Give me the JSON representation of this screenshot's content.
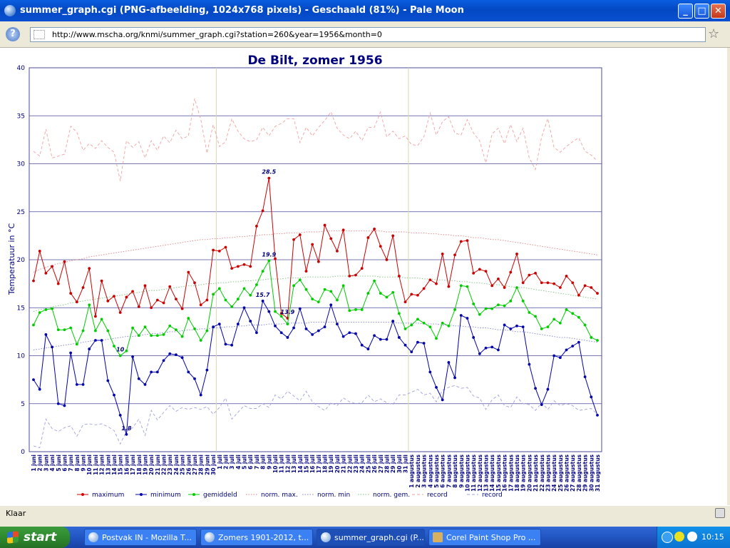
{
  "window": {
    "title": "summer_graph.cgi (PNG-afbeelding, 1024x768 pixels) - Geschaald (81%) - Pale Moon"
  },
  "navbar": {
    "url": "http://www.mscha.org/knmi/summer_graph.cgi?station=260&year=1956&month=0"
  },
  "statusbar": {
    "status": "Klaar"
  },
  "taskbar": {
    "start_label": "start",
    "tasks": [
      {
        "label": "Postvak IN - Mozilla T..."
      },
      {
        "label": "Zomers 1901-2012, t..."
      },
      {
        "label": "summer_graph.cgi (P..."
      },
      {
        "label": "Corel Paint Shop Pro ..."
      }
    ],
    "clock": "10:15"
  },
  "colors": {
    "maximum": "#cc0000",
    "minimum": "#0000aa",
    "gemiddeld": "#00cc00",
    "title": "#00007f",
    "grid": "#4b4b9a"
  },
  "chart_data": {
    "type": "line",
    "title": "De Bilt, zomer 1956",
    "ylabel": "Temperatuur in °C",
    "ylim": [
      0,
      40
    ],
    "yticks": [
      0,
      5,
      10,
      15,
      20,
      25,
      30,
      35,
      40
    ],
    "categories": [
      "1 juni",
      "2 juni",
      "3 juni",
      "4 juni",
      "5 juni",
      "6 juni",
      "7 juni",
      "8 juni",
      "9 juni",
      "10 juni",
      "11 juni",
      "12 juni",
      "13 juni",
      "14 juni",
      "15 juni",
      "16 juni",
      "17 juni",
      "18 juni",
      "19 juni",
      "20 juni",
      "21 juni",
      "22 juni",
      "23 juni",
      "24 juni",
      "25 juni",
      "26 juni",
      "27 juni",
      "28 juni",
      "29 juni",
      "30 juni",
      "1 juli",
      "2 juli",
      "3 juli",
      "4 juli",
      "5 juli",
      "6 juli",
      "7 juli",
      "8 juli",
      "9 juli",
      "10 juli",
      "11 juli",
      "12 juli",
      "13 juli",
      "14 juli",
      "15 juli",
      "16 juli",
      "17 juli",
      "18 juli",
      "19 juli",
      "20 juli",
      "21 juli",
      "22 juli",
      "23 juli",
      "24 juli",
      "25 juli",
      "26 juli",
      "27 juli",
      "28 juli",
      "29 juli",
      "30 juli",
      "31 juli",
      "1 augustus",
      "2 augustus",
      "3 augustus",
      "4 augustus",
      "5 augustus",
      "6 augustus",
      "7 augustus",
      "8 augustus",
      "9 augustus",
      "10 augustus",
      "11 augustus",
      "12 augustus",
      "13 augustus",
      "14 augustus",
      "15 augustus",
      "16 augustus",
      "17 augustus",
      "18 augustus",
      "19 augustus",
      "20 augustus",
      "21 augustus",
      "22 augustus",
      "23 augustus",
      "24 augustus",
      "25 augustus",
      "26 augustus",
      "27 augustus",
      "28 augustus",
      "29 augustus",
      "30 augustus",
      "31 augustus"
    ],
    "series": [
      {
        "name": "maximum",
        "style": "solid-dots",
        "color": "#cc0000",
        "values": [
          17.8,
          20.9,
          18.6,
          19.3,
          17.5,
          19.8,
          16.5,
          15.6,
          17.1,
          19.1,
          14.1,
          17.8,
          15.7,
          16.2,
          14.5,
          16.1,
          16.7,
          15.1,
          17.3,
          15.0,
          15.8,
          15.5,
          17.2,
          15.9,
          14.9,
          18.7,
          17.6,
          15.3,
          15.8,
          21.0,
          20.9,
          21.3,
          19.1,
          19.3,
          19.5,
          19.3,
          23.5,
          25.1,
          28.5,
          20.1,
          14.4,
          13.9,
          22.1,
          22.6,
          18.8,
          21.6,
          19.8,
          23.6,
          22.2,
          20.9,
          23.1,
          18.3,
          18.4,
          19.1,
          22.3,
          23.2,
          21.4,
          20.0,
          22.5,
          18.3,
          15.6,
          16.4,
          16.3,
          17.0,
          17.9,
          17.5,
          20.6,
          17.2,
          20.5,
          21.9,
          22.0,
          18.6,
          19.0,
          18.8,
          17.3,
          18.0,
          17.1,
          18.7,
          20.6,
          17.6,
          18.4,
          18.6,
          17.6,
          17.6,
          17.5,
          17.1,
          18.3,
          17.6,
          16.3,
          17.3,
          17.1,
          16.5
        ]
      },
      {
        "name": "minimum",
        "style": "solid-dots",
        "color": "#0000aa",
        "values": [
          7.5,
          6.5,
          12.2,
          10.9,
          5.0,
          4.8,
          10.3,
          7.0,
          7.0,
          10.7,
          11.6,
          11.6,
          7.4,
          5.9,
          3.8,
          1.8,
          9.9,
          7.6,
          7.0,
          8.3,
          8.3,
          9.5,
          10.2,
          10.1,
          9.8,
          8.3,
          7.6,
          5.9,
          8.5,
          13.0,
          13.3,
          11.2,
          11.1,
          13.3,
          15.0,
          13.6,
          12.4,
          15.7,
          14.6,
          13.1,
          12.4,
          11.9,
          12.9,
          14.9,
          12.8,
          12.2,
          12.6,
          13.0,
          15.3,
          13.3,
          12.0,
          12.4,
          12.3,
          11.1,
          10.7,
          12.1,
          11.7,
          11.7,
          13.6,
          11.9,
          11.1,
          10.4,
          11.4,
          11.3,
          8.3,
          6.7,
          5.4,
          9.3,
          7.7,
          14.2,
          13.9,
          11.9,
          10.2,
          10.8,
          10.9,
          10.6,
          13.2,
          12.8,
          13.1,
          13.0,
          9.1,
          6.6,
          4.9,
          6.5,
          10.0,
          9.8,
          10.6,
          11.0,
          11.4,
          7.8,
          5.7,
          3.8
        ]
      },
      {
        "name": "gemiddeld",
        "style": "solid-dots",
        "color": "#00cc00",
        "values": [
          13.2,
          14.5,
          14.8,
          14.9,
          12.7,
          12.7,
          12.9,
          11.2,
          12.6,
          15.3,
          12.6,
          13.8,
          12.6,
          11.0,
          10.0,
          10.5,
          12.9,
          12.1,
          13.0,
          12.1,
          12.1,
          12.2,
          13.1,
          12.7,
          12.0,
          13.9,
          12.8,
          11.6,
          12.6,
          16.4,
          17.0,
          15.8,
          15.1,
          15.9,
          17.0,
          16.3,
          17.4,
          18.8,
          19.9,
          14.6,
          14.1,
          13.3,
          17.3,
          17.9,
          16.9,
          15.9,
          15.6,
          16.9,
          16.7,
          15.8,
          17.3,
          14.7,
          14.8,
          14.8,
          16.5,
          17.8,
          16.5,
          16.1,
          16.6,
          14.4,
          12.8,
          13.2,
          13.8,
          13.4,
          13.0,
          11.8,
          13.4,
          13.1,
          14.8,
          17.3,
          17.2,
          15.4,
          14.3,
          14.9,
          14.9,
          15.3,
          15.2,
          15.7,
          17.1,
          15.7,
          14.5,
          14.1,
          12.8,
          13.0,
          13.8,
          13.4,
          14.8,
          14.4,
          14.0,
          13.2,
          11.9,
          11.6
        ]
      },
      {
        "name": "norm. max.",
        "style": "dotted",
        "color": "#e08080",
        "values": [
          18.7,
          19.0,
          19.2,
          19.4,
          19.6,
          19.7,
          19.9,
          20.0,
          20.1,
          20.3,
          20.4,
          20.5,
          20.6,
          20.7,
          20.8,
          20.9,
          21.0,
          21.1,
          21.2,
          21.3,
          21.4,
          21.5,
          21.6,
          21.7,
          21.8,
          21.9,
          22.0,
          22.1,
          22.1,
          22.2,
          22.2,
          22.3,
          22.3,
          22.4,
          22.4,
          22.5,
          22.5,
          22.6,
          22.6,
          22.7,
          22.7,
          22.8,
          22.8,
          22.8,
          22.9,
          22.9,
          22.9,
          23.0,
          23.0,
          23.0,
          23.0,
          23.0,
          23.0,
          23.0,
          23.0,
          23.0,
          23.0,
          22.9,
          22.9,
          22.9,
          22.9,
          22.8,
          22.8,
          22.8,
          22.7,
          22.7,
          22.6,
          22.6,
          22.5,
          22.5,
          22.4,
          22.3,
          22.3,
          22.2,
          22.1,
          22.1,
          22.0,
          21.9,
          21.8,
          21.7,
          21.6,
          21.5,
          21.4,
          21.3,
          21.2,
          21.1,
          21.0,
          20.9,
          20.8,
          20.7,
          20.6,
          20.5
        ]
      },
      {
        "name": "norm. min",
        "style": "dotted",
        "color": "#8080d0",
        "values": [
          10.6,
          10.7,
          10.8,
          10.9,
          11.0,
          11.1,
          11.2,
          11.3,
          11.4,
          11.5,
          11.6,
          11.6,
          11.7,
          11.8,
          11.9,
          12.0,
          12.0,
          12.1,
          12.2,
          12.3,
          12.3,
          12.4,
          12.5,
          12.5,
          12.6,
          12.7,
          12.7,
          12.8,
          12.8,
          12.9,
          12.9,
          13.0,
          13.0,
          13.1,
          13.1,
          13.2,
          13.2,
          13.2,
          13.3,
          13.3,
          13.3,
          13.4,
          13.4,
          13.4,
          13.4,
          13.5,
          13.5,
          13.5,
          13.5,
          13.5,
          13.5,
          13.5,
          13.5,
          13.5,
          13.5,
          13.5,
          13.5,
          13.5,
          13.5,
          13.4,
          13.4,
          13.4,
          13.4,
          13.3,
          13.3,
          13.3,
          13.2,
          13.2,
          13.1,
          13.1,
          13.0,
          13.0,
          12.9,
          12.9,
          12.8,
          12.7,
          12.7,
          12.6,
          12.5,
          12.5,
          12.4,
          12.3,
          12.2,
          12.1,
          12.0,
          11.9,
          11.9,
          11.8,
          11.7,
          11.6,
          11.5,
          11.4
        ]
      },
      {
        "name": "norm. gem.",
        "style": "dotted",
        "color": "#80c080",
        "values": [
          14.6,
          14.8,
          14.9,
          15.1,
          15.2,
          15.3,
          15.5,
          15.6,
          15.7,
          15.8,
          15.9,
          16.0,
          16.1,
          16.2,
          16.3,
          16.4,
          16.5,
          16.6,
          16.7,
          16.8,
          16.8,
          16.9,
          17.0,
          17.1,
          17.2,
          17.3,
          17.3,
          17.4,
          17.5,
          17.5,
          17.6,
          17.6,
          17.7,
          17.7,
          17.8,
          17.8,
          17.9,
          17.9,
          18.0,
          18.0,
          18.0,
          18.1,
          18.1,
          18.1,
          18.2,
          18.2,
          18.2,
          18.2,
          18.2,
          18.3,
          18.3,
          18.3,
          18.3,
          18.3,
          18.3,
          18.3,
          18.2,
          18.2,
          18.2,
          18.2,
          18.1,
          18.1,
          18.1,
          18.0,
          18.0,
          17.9,
          17.9,
          17.8,
          17.8,
          17.7,
          17.7,
          17.6,
          17.6,
          17.5,
          17.4,
          17.4,
          17.3,
          17.2,
          17.1,
          17.1,
          17.0,
          16.9,
          16.8,
          16.7,
          16.6,
          16.5,
          16.4,
          16.3,
          16.2,
          16.1,
          16.0,
          15.9
        ]
      },
      {
        "name": "record",
        "style": "dashed",
        "color": "#f0a0a0",
        "values": [
          31.3,
          30.8,
          33.6,
          30.6,
          30.8,
          31.0,
          33.9,
          33.3,
          31.4,
          32.1,
          31.6,
          32.4,
          31.7,
          31.2,
          28.2,
          32.4,
          31.7,
          32.3,
          30.6,
          32.4,
          31.4,
          32.9,
          32.2,
          33.5,
          32.6,
          32.9,
          36.8,
          34.6,
          31.1,
          34.1,
          31.8,
          32.3,
          34.7,
          33.4,
          32.6,
          32.3,
          32.5,
          33.8,
          32.9,
          33.9,
          34.2,
          34.7,
          34.7,
          32.2,
          33.8,
          32.9,
          33.8,
          34.5,
          35.4,
          33.7,
          33.0,
          32.6,
          33.4,
          32.4,
          33.8,
          33.8,
          35.4,
          32.8,
          33.4,
          32.6,
          32.9,
          32.0,
          31.9,
          32.8,
          35.3,
          33.0,
          34.4,
          34.9,
          33.2,
          33.0,
          34.6,
          33.2,
          32.4,
          30.1,
          33.1,
          33.7,
          32.1,
          34.1,
          32.3,
          33.7,
          30.6,
          29.4,
          32.8,
          34.7,
          31.7,
          31.2,
          31.8,
          32.3,
          32.7,
          31.3,
          30.9,
          30.3
        ]
      },
      {
        "name": "record",
        "style": "dashed",
        "color": "#a0a0e0",
        "values": [
          0.6,
          0.4,
          3.4,
          2.4,
          2.1,
          2.5,
          2.7,
          1.6,
          2.8,
          2.9,
          2.8,
          2.9,
          2.6,
          2.2,
          0.8,
          2.1,
          2.5,
          3.4,
          1.7,
          4.3,
          3.3,
          4.1,
          4.8,
          4.2,
          4.6,
          4.4,
          4.6,
          4.4,
          4.7,
          3.9,
          4.6,
          5.6,
          3.4,
          4.1,
          4.8,
          4.5,
          4.5,
          5.0,
          4.6,
          5.9,
          5.5,
          6.3,
          5.8,
          5.3,
          6.3,
          5.2,
          4.7,
          4.3,
          5.1,
          4.8,
          5.6,
          5.2,
          5.0,
          5.1,
          5.9,
          5.2,
          5.5,
          5.1,
          4.9,
          5.9,
          5.9,
          6.2,
          6.5,
          5.9,
          6.1,
          5.2,
          6.4,
          6.7,
          6.9,
          6.6,
          6.7,
          5.8,
          5.6,
          4.4,
          5.4,
          5.9,
          4.8,
          4.6,
          5.7,
          5.0,
          4.9,
          4.3,
          5.1,
          4.4,
          5.3,
          4.8,
          5.0,
          4.8,
          4.3,
          4.4,
          4.5,
          3.9
        ]
      }
    ],
    "annotations": [
      {
        "label": "28.5",
        "series": "maximum",
        "x": "9 juli",
        "y": 28.5
      },
      {
        "label": "19.9",
        "series": "gemiddeld",
        "x": "9 juli",
        "y": 19.9
      },
      {
        "label": "15.7",
        "series": "minimum",
        "x": "8 juli",
        "y": 15.7
      },
      {
        "label": "13.9",
        "series": "maximum",
        "x": "12 juli",
        "y": 13.9
      },
      {
        "label": "10",
        "series": "gemiddeld",
        "x": "15 juni",
        "y": 10.0
      },
      {
        "label": "1.8",
        "series": "minimum",
        "x": "16 juni",
        "y": 1.8
      }
    ],
    "legend_position": "bottom",
    "grid": true
  }
}
